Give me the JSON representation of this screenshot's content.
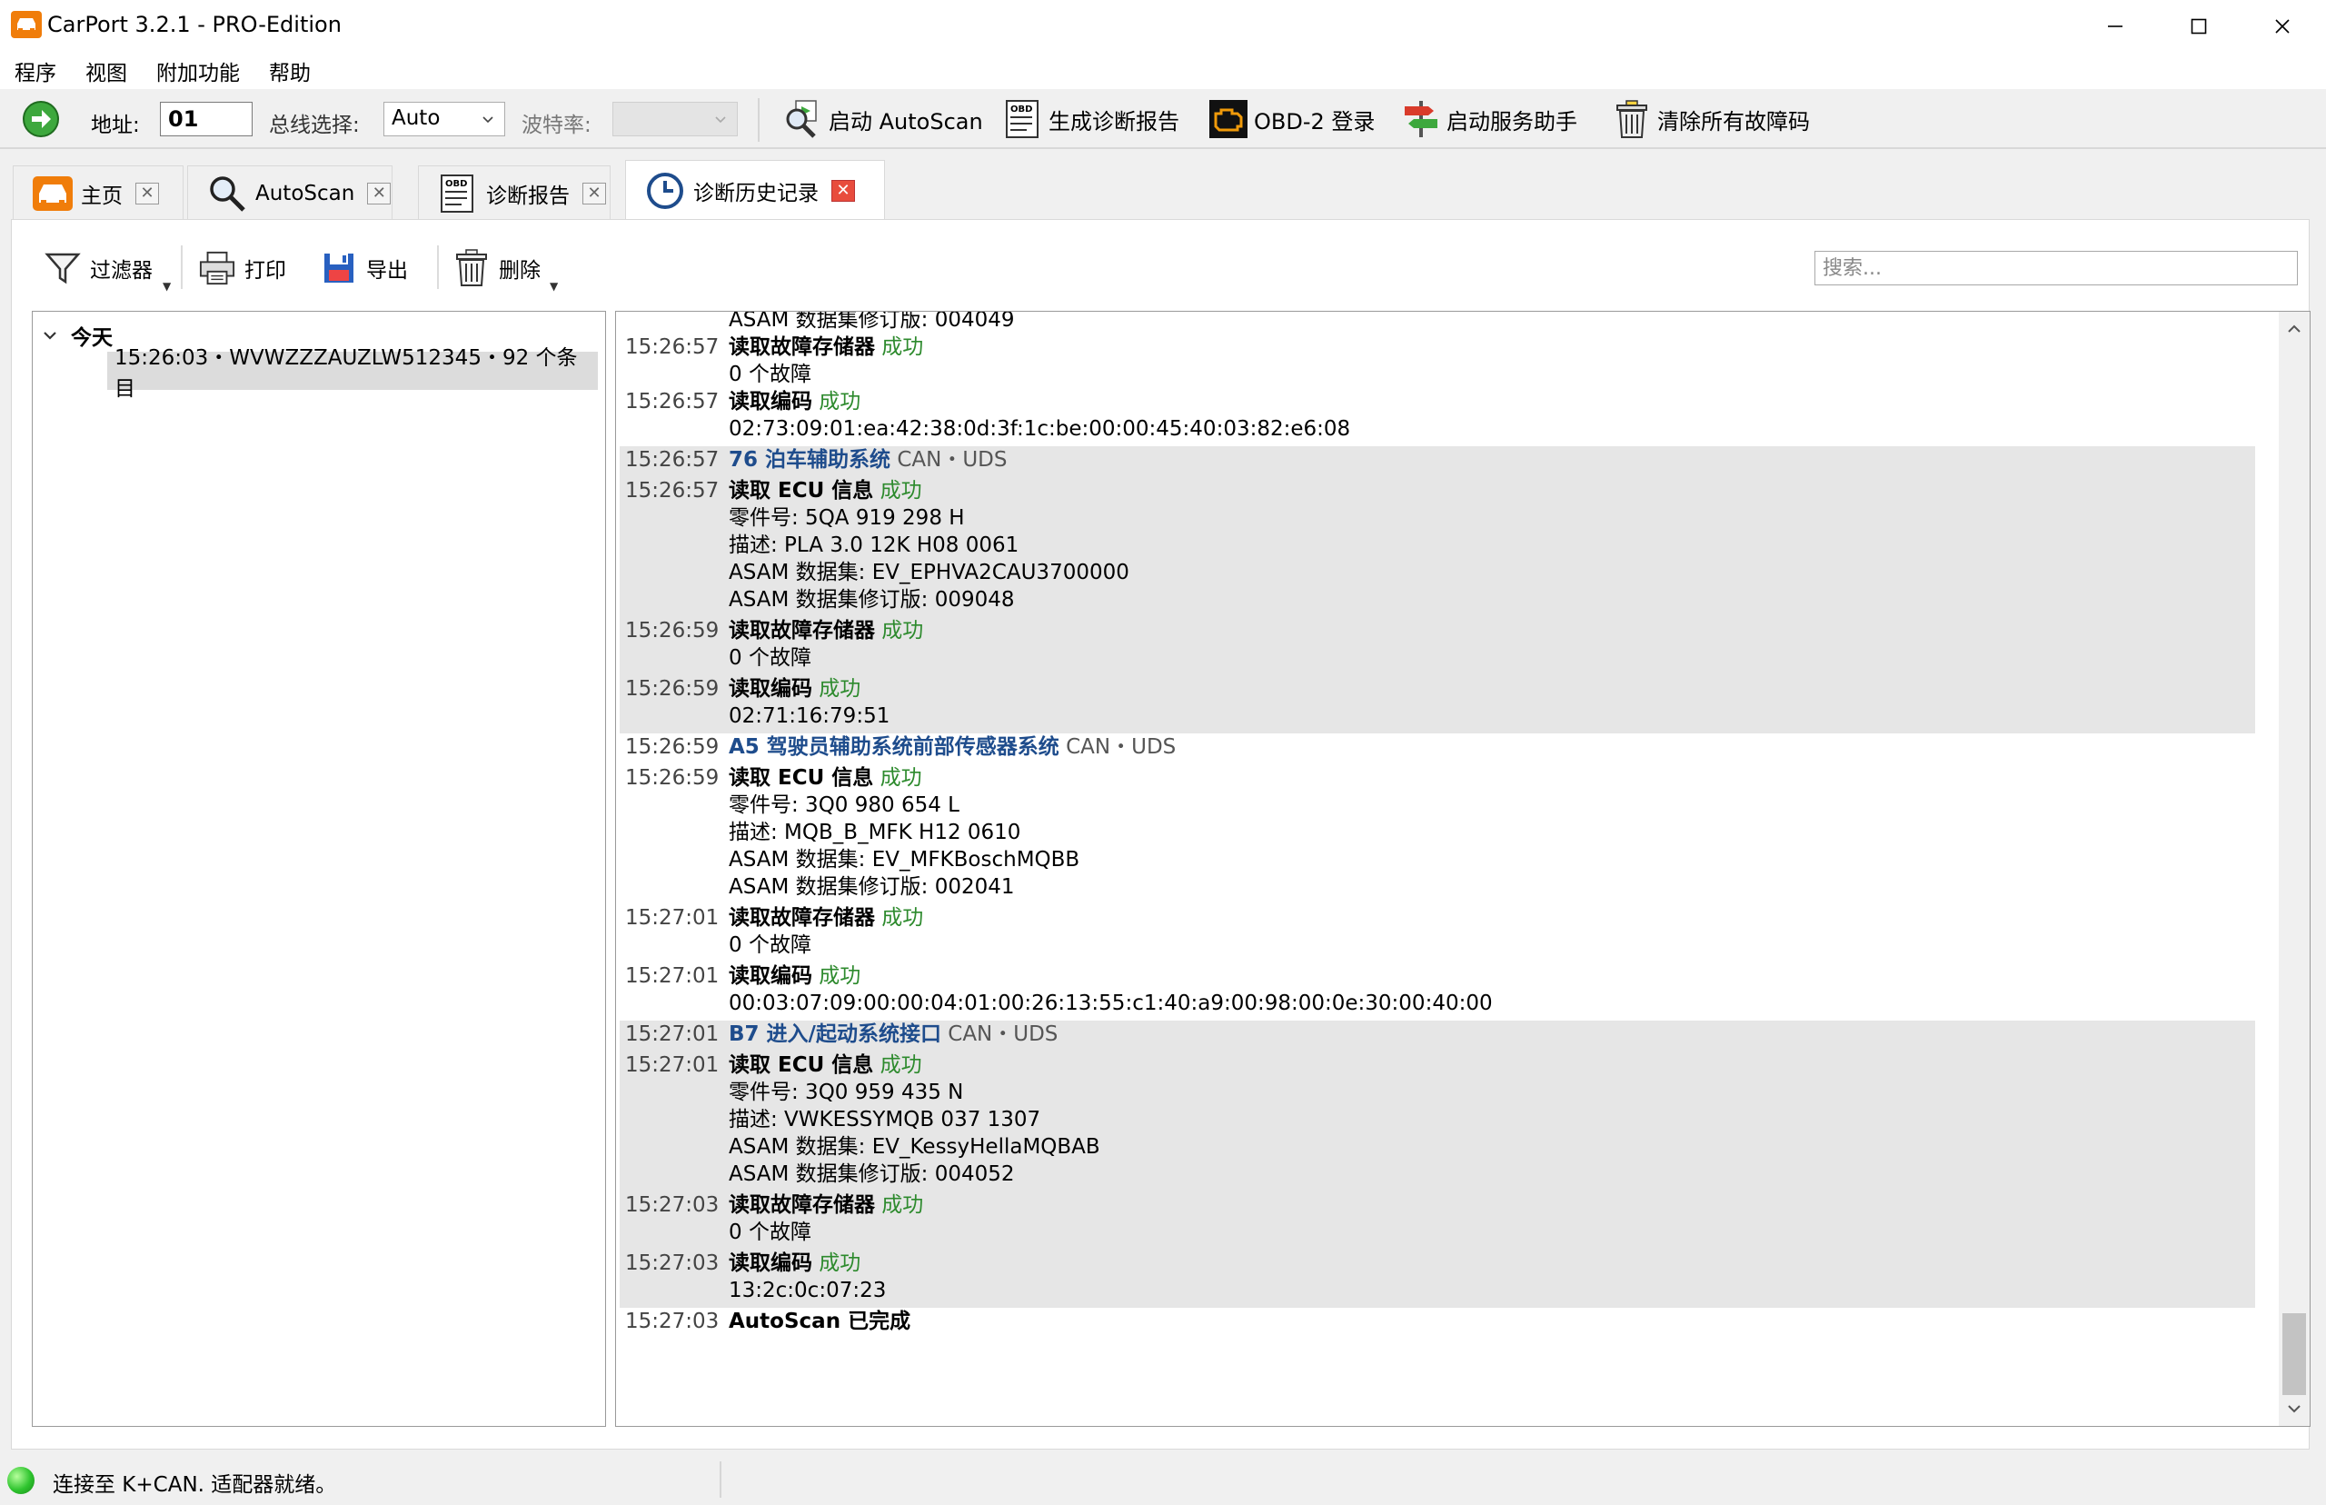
{
  "window": {
    "title": "CarPort 3.2.1 - PRO-Edition"
  },
  "menu": [
    "程序",
    "视图",
    "附加功能",
    "帮助"
  ],
  "toolbar": {
    "address_label": "地址:",
    "address_value": "01",
    "bus_label": "总线选择:",
    "bus_value": "Auto",
    "baud_label": "波特率:",
    "buttons": {
      "autoscan": "启动 AutoScan",
      "report": "生成诊断报告",
      "obd_login": "OBD-2 登录",
      "service": "启动服务助手",
      "clear": "清除所有故障码"
    }
  },
  "tabs": [
    {
      "label": "主页",
      "icon": "car-icon"
    },
    {
      "label": "AutoScan",
      "icon": "magnifier-icon"
    },
    {
      "label": "诊断报告",
      "icon": "obd-report-icon"
    },
    {
      "label": "诊断历史记录",
      "icon": "clock-icon",
      "active": true
    }
  ],
  "subtoolbar": {
    "filter": "过滤器",
    "print": "打印",
    "export": "导出",
    "delete": "删除",
    "search_placeholder": "搜索..."
  },
  "tree": {
    "root": "今天",
    "child": "15:26:03・WVWZZZAUZLW512345・92 个条目"
  },
  "log": [
    {
      "shaded": false,
      "lines": [
        {
          "time": "",
          "parts": [
            [
              "ASAM 数据集修订版: 004049",
              ""
            ]
          ]
        },
        {
          "time": "15:26:57",
          "parts": [
            [
              "读取故障存储器",
              "op"
            ],
            [
              " 成功",
              "ok"
            ]
          ]
        },
        {
          "time": "",
          "parts": [
            [
              "0 个故障",
              ""
            ]
          ]
        },
        {
          "time": "15:26:57",
          "parts": [
            [
              "读取编码",
              "op"
            ],
            [
              " 成功",
              "ok"
            ]
          ]
        },
        {
          "time": "",
          "parts": [
            [
              "02:73:09:01:ea:42:38:0d:3f:1c:be:00:00:45:40:03:82:e6:08",
              ""
            ]
          ]
        }
      ]
    },
    {
      "shaded": true,
      "lines": [
        {
          "time": "15:26:57",
          "parts": [
            [
              "76 泊车辅助系统",
              "hdr"
            ],
            [
              "  CAN・UDS",
              "proto"
            ]
          ]
        },
        {
          "time": "15:26:57",
          "gap": true,
          "parts": [
            [
              "读取 ECU 信息",
              "op"
            ],
            [
              " 成功",
              "ok"
            ]
          ]
        },
        {
          "time": "",
          "parts": [
            [
              "零件号: 5QA 919 298 H",
              ""
            ]
          ]
        },
        {
          "time": "",
          "parts": [
            [
              "描述: PLA 3.0 12K H08 0061",
              ""
            ]
          ]
        },
        {
          "time": "",
          "parts": [
            [
              "ASAM 数据集: EV_EPHVA2CAU3700000",
              ""
            ]
          ]
        },
        {
          "time": "",
          "parts": [
            [
              "ASAM 数据集修订版: 009048",
              ""
            ]
          ]
        },
        {
          "time": "15:26:59",
          "gap": true,
          "parts": [
            [
              "读取故障存储器",
              "op"
            ],
            [
              " 成功",
              "ok"
            ]
          ]
        },
        {
          "time": "",
          "parts": [
            [
              "0 个故障",
              ""
            ]
          ]
        },
        {
          "time": "15:26:59",
          "gap": true,
          "parts": [
            [
              "读取编码",
              "op"
            ],
            [
              " 成功",
              "ok"
            ]
          ]
        },
        {
          "time": "",
          "parts": [
            [
              "02:71:16:79:51",
              ""
            ]
          ]
        }
      ]
    },
    {
      "shaded": false,
      "lines": [
        {
          "time": "15:26:59",
          "parts": [
            [
              "A5 驾驶员辅助系统前部传感器系统",
              "hdr"
            ],
            [
              "  CAN・UDS",
              "proto"
            ]
          ]
        },
        {
          "time": "15:26:59",
          "gap": true,
          "parts": [
            [
              "读取 ECU 信息",
              "op"
            ],
            [
              " 成功",
              "ok"
            ]
          ]
        },
        {
          "time": "",
          "parts": [
            [
              "零件号: 3Q0 980 654 L",
              ""
            ]
          ]
        },
        {
          "time": "",
          "parts": [
            [
              "描述: MQB_B_MFK H12 0610",
              ""
            ]
          ]
        },
        {
          "time": "",
          "parts": [
            [
              "ASAM 数据集: EV_MFKBoschMQBB",
              ""
            ]
          ]
        },
        {
          "time": "",
          "parts": [
            [
              "ASAM 数据集修订版: 002041",
              ""
            ]
          ]
        },
        {
          "time": "15:27:01",
          "gap": true,
          "parts": [
            [
              "读取故障存储器",
              "op"
            ],
            [
              " 成功",
              "ok"
            ]
          ]
        },
        {
          "time": "",
          "parts": [
            [
              "0 个故障",
              ""
            ]
          ]
        },
        {
          "time": "15:27:01",
          "gap": true,
          "parts": [
            [
              "读取编码",
              "op"
            ],
            [
              " 成功",
              "ok"
            ]
          ]
        },
        {
          "time": "",
          "parts": [
            [
              "00:03:07:09:00:00:04:01:00:26:13:55:c1:40:a9:00:98:00:0e:30:00:40:00",
              ""
            ]
          ]
        }
      ]
    },
    {
      "shaded": true,
      "lines": [
        {
          "time": "15:27:01",
          "parts": [
            [
              "B7 进入/起动系统接口",
              "hdr"
            ],
            [
              "  CAN・UDS",
              "proto"
            ]
          ]
        },
        {
          "time": "15:27:01",
          "gap": true,
          "parts": [
            [
              "读取 ECU 信息",
              "op"
            ],
            [
              " 成功",
              "ok"
            ]
          ]
        },
        {
          "time": "",
          "parts": [
            [
              "零件号: 3Q0 959 435 N",
              ""
            ]
          ]
        },
        {
          "time": "",
          "parts": [
            [
              "描述: VWKESSYMQB 037 1307",
              ""
            ]
          ]
        },
        {
          "time": "",
          "parts": [
            [
              "ASAM 数据集: EV_KessyHellaMQBAB",
              ""
            ]
          ]
        },
        {
          "time": "",
          "parts": [
            [
              "ASAM 数据集修订版: 004052",
              ""
            ]
          ]
        },
        {
          "time": "15:27:03",
          "gap": true,
          "parts": [
            [
              "读取故障存储器",
              "op"
            ],
            [
              " 成功",
              "ok"
            ]
          ]
        },
        {
          "time": "",
          "parts": [
            [
              "0 个故障",
              ""
            ]
          ]
        },
        {
          "time": "15:27:03",
          "gap": true,
          "parts": [
            [
              "读取编码",
              "op"
            ],
            [
              " 成功",
              "ok"
            ]
          ]
        },
        {
          "time": "",
          "parts": [
            [
              "13:2c:0c:07:23",
              ""
            ]
          ]
        }
      ]
    },
    {
      "shaded": false,
      "lines": [
        {
          "time": "15:27:03",
          "parts": [
            [
              "AutoScan 已完成",
              "op"
            ]
          ]
        }
      ]
    }
  ],
  "status": {
    "text": "连接至 K+CAN. 适配器就绪。"
  },
  "colors": {
    "accent_orange": "#f07d0a",
    "success_green": "#2d8a2d",
    "header_blue": "#1e4c8c",
    "close_red": "#e84c3d"
  }
}
